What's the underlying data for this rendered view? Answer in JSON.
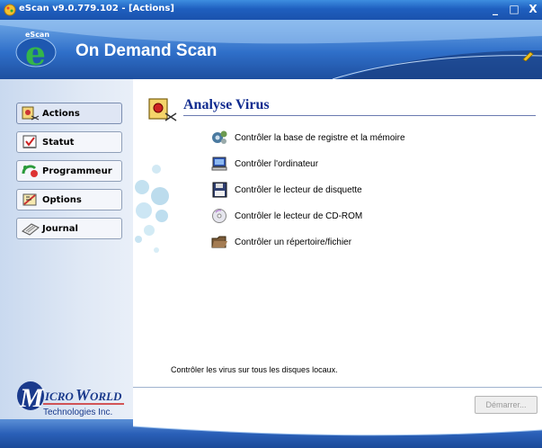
{
  "window": {
    "title": "eScan v9.0.779.102 - [Actions]",
    "minimize_glyph": "_",
    "maximize_glyph": "□",
    "close_glyph": "X"
  },
  "header": {
    "logo_caption": "eScan",
    "title": "On Demand Scan"
  },
  "sidebar": {
    "items": [
      {
        "label": "Actions",
        "icon": "virus-arrow-icon",
        "active": true
      },
      {
        "label": "Statut",
        "icon": "checkbox-icon",
        "active": false
      },
      {
        "label": "Programmeur",
        "icon": "scheduler-icon",
        "active": false
      },
      {
        "label": "Options",
        "icon": "options-icon",
        "active": false
      },
      {
        "label": "Journal",
        "icon": "journal-icon",
        "active": false
      }
    ],
    "brand": {
      "name": "MICROWORLD",
      "initial": "M",
      "rest": "ICRO",
      "initial2": "W",
      "rest2": "ORLD",
      "subtitle": "Technologies Inc."
    }
  },
  "main": {
    "section_title": "Analyse Virus",
    "actions": [
      {
        "label": "Contrôler la base de registre et la mémoire",
        "icon": "registry-memory-icon"
      },
      {
        "label": "Contrôler l'ordinateur",
        "icon": "computer-icon"
      },
      {
        "label": "Contrôler le lecteur de disquette",
        "icon": "floppy-disk-icon"
      },
      {
        "label": "Contrôler le lecteur de CD-ROM",
        "icon": "cd-rom-icon"
      },
      {
        "label": "Contrôler un répertoire/fichier",
        "icon": "folder-icon"
      }
    ],
    "hint": "Contrôler les virus sur tous les disques locaux.",
    "start_button": "Démarrer..."
  },
  "colors": {
    "titlebar": "#1f5fbf",
    "header": "#2f6fc9",
    "sidebar": "#dfe8f5",
    "section_title": "#0f2b8f",
    "brand": "#1a3a8c"
  }
}
